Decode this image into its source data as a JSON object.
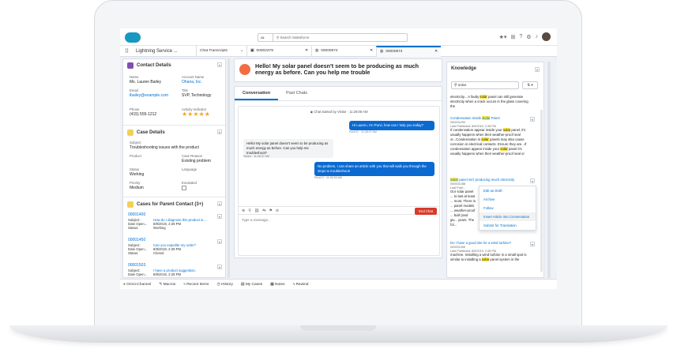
{
  "global": {
    "search_scope": "All",
    "search_placeholder": "Search Salesforce"
  },
  "nav": {
    "app_name": "Lightning Service ...",
    "tabs": [
      {
        "label": "Chat Transcripts"
      },
      {
        "label": "00002379"
      },
      {
        "label": "00000972"
      },
      {
        "label": "00000974"
      }
    ]
  },
  "contact": {
    "title": "Contact Details",
    "name_label": "Name",
    "name": "Ms. Lauren Bailey",
    "account_label": "Account Name",
    "account": "Ohana, Inc.",
    "email_label": "Email",
    "email": "lbailey@example.com",
    "title_label": "Title",
    "title_value": "SVP, Technology",
    "phone_label": "Phone",
    "phone": "(415) 555-1212",
    "activity_label": "Activity Indicator",
    "stars": "★★★★★"
  },
  "case_details": {
    "title": "Case Details",
    "subject_label": "Subject",
    "subject": "Troubleshooting issues with the product",
    "product_label": "Product",
    "reason_label": "Case Reason",
    "reason": "Existing problem",
    "status_label": "Status",
    "status": "Working",
    "language_label": "Language",
    "priority_label": "Priority",
    "priority": "Medium",
    "escalated_label": "Escalated"
  },
  "cases": {
    "title": "Cases for Parent Contact (3+)",
    "items": [
      {
        "number": "00001400",
        "subject_label": "Subject:",
        "subject": "How do I diagnose this product is...",
        "date_label": "Date Open...",
        "date": "8/9/2019, 2:28 PM",
        "status_label": "Status:",
        "status": "Working"
      },
      {
        "number": "00001450",
        "subject_label": "Subject:",
        "subject": "Can you expedite my order?",
        "date_label": "Date Open...",
        "date": "8/9/2019, 2:28 PM",
        "status_label": "Status:",
        "status": "Closed"
      },
      {
        "number": "00001503",
        "subject_label": "Subject:",
        "subject": "I have a product suggestion.",
        "date_label": "Date Open...",
        "date": "8/9/2019, 2:28 PM"
      }
    ]
  },
  "chat": {
    "title": "Hello! My solar panel doesn't seem to be producing as much energy as before. Can you help me trouble",
    "tab_conversation": "Conversation",
    "tab_past": "Past Chats",
    "started": "Chat started by Visitor · 11:28:06 AM",
    "messages": [
      {
        "text": "Hi Lauren, I'm Purvi, how can I help you today?",
        "meta": "Purvi D · 11:28:27 AM"
      },
      {
        "text": "Hello! My solar panel doesn't seem to be producing as much energy as before. Can you help me troubleshoot?",
        "meta": "Visitor · 11:28:37 AM"
      },
      {
        "text": "No problem, I can share an article with you that will walk you through the steps to troubleshoot!",
        "meta": "Purvi D · 11:30:53 AM"
      }
    ],
    "end_label": "End Chat",
    "input_placeholder": "Type a message..."
  },
  "knowledge": {
    "title": "Knowledge",
    "search_value": "solar",
    "r0": {
      "a": "electricity... A faulty ",
      "hl": "solar",
      "b": " panel can still generate electricity when a crack occurs in the glass covering the"
    },
    "r1": {
      "title_a": "Condensation Inside ",
      "title_hl": "Solar",
      "title_b": " Panel",
      "number": "000001290",
      "date": "Last Published: 8/9/2019, 2:28 PM",
      "text_a": "If condensation appear inside your ",
      "hl1": "solar",
      "text_b": " panel, it's usually happens when their weather-proof seal or...Condensation in ",
      "hl2": "solar",
      "text_c": " panels may also cause corrosion in electrical contacts. Ensure they are...If condensation appear inside your ",
      "hl3": "solar",
      "text_d": " panel it's usually happens when their weather-proof seal or"
    },
    "r2": {
      "title_hl": "Solar",
      "title_b": " panel isn't producing much electricity",
      "number": "000001288",
      "date": "Last Publ...",
      "text": "Our solar panel ... to last at least ... most. There is ... panel models ... weather-proof ... built (and giv... years. The fol..."
    },
    "menu": [
      "Edit as Draft",
      "Archive",
      "Follow",
      "Insert Article into Conversation",
      "Submit for Translation"
    ],
    "r3": {
      "title": "Do I have a good site for a wind turbine?",
      "number": "000001269",
      "date": "Last Published: 8/9/2019, 2:28 PM",
      "text_a": "machine. Installing a wind turbine in a small spot is similar to installing a ",
      "hl": "solar",
      "text_b": " panel system in the"
    }
  },
  "utility": [
    "Omni-Channel",
    "Macros",
    "Recent Items",
    "History",
    "My Cases",
    "Notes",
    "Rewind"
  ]
}
